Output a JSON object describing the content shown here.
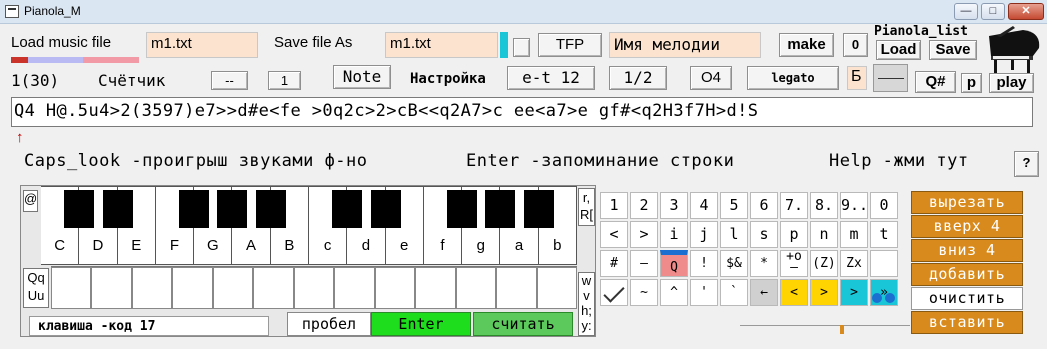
{
  "window": {
    "title": "Pianola_M",
    "min": "—",
    "max": "□",
    "close": "✕"
  },
  "top": {
    "load_label": "Load music file",
    "load_value": "m1.txt",
    "save_label": "Save file As",
    "save_value": "m1.txt",
    "tfp": "TFP",
    "melody_name": "Имя мелодии",
    "make": "make",
    "zero": "0",
    "pianola_list": "Pianola_list",
    "list_load": "Load",
    "list_save": "Save"
  },
  "row2": {
    "counter": "1(30)",
    "counter_label": "Счётчик",
    "dash": "--",
    "one": "1",
    "note": "Note",
    "settings": "Настройка",
    "et12": "e-t 12",
    "half": "1/2",
    "o4": "O4",
    "legato": "legato",
    "b": "Б",
    "qsharp": "Q#",
    "p": "p",
    "play": "play"
  },
  "code": "Q4 H@.5u4>2(3597)e7>>d#e<fe >0q2c>2>cB<<q2A7>c ee<a7>e gf#<q2H3f7H>d!S",
  "hint": {
    "caps": "Caps_look -проигрыш звуками ф-но",
    "enter": "Enter -запоминание строки",
    "help": "Help -жми тут",
    "help_btn": "?"
  },
  "piano": {
    "at": "@",
    "notes": [
      "C",
      "D",
      "E",
      "F",
      "G",
      "A",
      "B",
      "c",
      "d",
      "e",
      "f",
      "g",
      "a",
      "b"
    ],
    "side_left": [
      "Qq",
      "Uu"
    ],
    "side_right_top": [
      "r,",
      "R["
    ],
    "side_right_bottom": [
      "w",
      "v",
      "h;",
      "y:"
    ],
    "status": "клавиша -код 17",
    "space": "пробел",
    "enter": "Enter",
    "read": "считать"
  },
  "grid": {
    "row1": [
      "1",
      "2",
      "3",
      "4",
      "5",
      "6",
      "7.",
      "8.",
      "9..",
      "0"
    ],
    "row2": [
      "<",
      ">",
      "i",
      "j",
      "l",
      "s",
      "p",
      "n",
      "m",
      "t"
    ],
    "row3": [
      "#",
      "–",
      "Q",
      "!",
      "$&",
      "*",
      "+o\n–",
      "(Z)",
      "Zx",
      ""
    ],
    "row4": [
      "",
      "~",
      "^",
      "'",
      "`",
      "←",
      "<",
      ">",
      ">",
      "»"
    ]
  },
  "side": {
    "cut": "вырезать",
    "up": "вверх 4",
    "down": "вниз 4",
    "add": "добавить",
    "clear": "очистить",
    "paste": "вставить"
  },
  "colors": {
    "input_bg": "#fbe3cf",
    "enter_green": "#1ddd1d",
    "read_green": "#5cc95c",
    "orange": "#d98a1c",
    "cyan": "#19c6d8",
    "yellow": "#ffd400"
  }
}
